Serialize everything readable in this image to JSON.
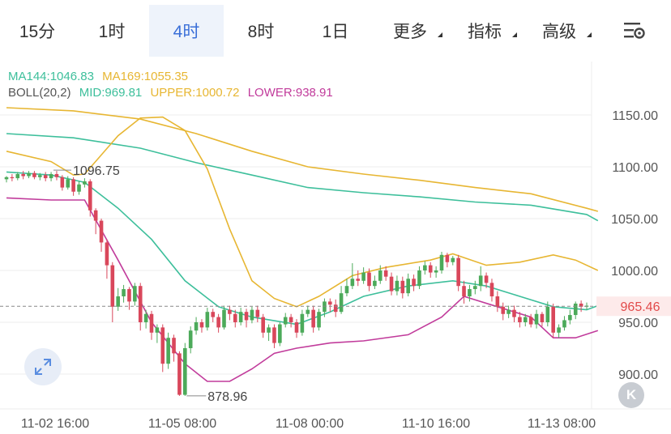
{
  "tabs": [
    {
      "label": "15分",
      "active": false,
      "dropdown": false
    },
    {
      "label": "1时",
      "active": false,
      "dropdown": false
    },
    {
      "label": "4时",
      "active": true,
      "dropdown": false
    },
    {
      "label": "8时",
      "active": false,
      "dropdown": false
    },
    {
      "label": "1日",
      "active": false,
      "dropdown": false
    },
    {
      "label": "更多",
      "active": false,
      "dropdown": true
    },
    {
      "label": "指标",
      "active": false,
      "dropdown": true
    },
    {
      "label": "高级",
      "active": false,
      "dropdown": true
    }
  ],
  "indicators": {
    "ma144": "MA144:1046.83",
    "ma169": "MA169:1055.35",
    "boll": "BOLL(20,2)",
    "mid": "MID:969.81",
    "upper": "UPPER:1000.72",
    "lower": "LOWER:938.91"
  },
  "colors": {
    "ma144": "#3dbf9b",
    "ma169": "#e7b632",
    "mid": "#3dbf9b",
    "upper": "#e7b632",
    "lower": "#c13b9b",
    "up": "#4caa5a",
    "down": "#d9475b",
    "price_tag": "#e24a4a",
    "text": "#555555"
  },
  "chart_data": {
    "type": "candlestick",
    "x_ticks": [
      "11-02 16:00",
      "11-05 08:00",
      "11-08 00:00",
      "11-10 16:00",
      "11-13 08:00"
    ],
    "y_ticks": [
      1150.0,
      1100.0,
      1050.0,
      1000.0,
      950.0,
      900.0
    ],
    "ylim": [
      880,
      1165
    ],
    "current_price": 965.46,
    "annotations": {
      "high": 1096.75,
      "low": 878.96
    },
    "candles": [
      [
        1088,
        1090,
        1085,
        1091
      ],
      [
        1090,
        1089,
        1086,
        1093
      ],
      [
        1089,
        1093,
        1087,
        1095
      ],
      [
        1093,
        1091,
        1088,
        1096
      ],
      [
        1091,
        1094,
        1089,
        1096
      ],
      [
        1094,
        1090,
        1088,
        1096
      ],
      [
        1090,
        1092,
        1087,
        1094
      ],
      [
        1092,
        1089,
        1086,
        1095
      ],
      [
        1089,
        1093,
        1086,
        1095
      ],
      [
        1093,
        1090,
        1087,
        1096
      ],
      [
        1090,
        1080,
        1077,
        1092
      ],
      [
        1080,
        1088,
        1078,
        1091
      ],
      [
        1088,
        1076,
        1072,
        1090
      ],
      [
        1076,
        1083,
        1073,
        1086
      ],
      [
        1083,
        1086,
        1080,
        1089
      ],
      [
        1086,
        1058,
        1052,
        1088
      ],
      [
        1058,
        1048,
        1035,
        1060
      ],
      [
        1048,
        1027,
        1018,
        1050
      ],
      [
        1027,
        1005,
        992,
        1030
      ],
      [
        1005,
        965,
        950,
        1008
      ],
      [
        965,
        975,
        961,
        983
      ],
      [
        975,
        982,
        969,
        986
      ],
      [
        982,
        970,
        962,
        984
      ],
      [
        970,
        985,
        966,
        988
      ],
      [
        985,
        950,
        942,
        988
      ],
      [
        950,
        958,
        944,
        962
      ],
      [
        958,
        940,
        933,
        961
      ],
      [
        940,
        945,
        930,
        948
      ],
      [
        945,
        910,
        902,
        948
      ],
      [
        910,
        935,
        905,
        940
      ],
      [
        935,
        920,
        912,
        938
      ],
      [
        920,
        880,
        878.96,
        922
      ],
      [
        880,
        925,
        878.96,
        930
      ],
      [
        925,
        942,
        920,
        946
      ],
      [
        942,
        950,
        938,
        955
      ],
      [
        950,
        945,
        940,
        953
      ],
      [
        945,
        960,
        942,
        964
      ],
      [
        960,
        955,
        950,
        963
      ],
      [
        955,
        945,
        940,
        958
      ],
      [
        945,
        962,
        943,
        966
      ],
      [
        962,
        958,
        952,
        966
      ],
      [
        958,
        950,
        945,
        962
      ],
      [
        950,
        960,
        947,
        964
      ],
      [
        960,
        952,
        945,
        963
      ],
      [
        952,
        962,
        949,
        965
      ],
      [
        962,
        955,
        950,
        966
      ],
      [
        955,
        940,
        935,
        958
      ],
      [
        940,
        945,
        932,
        948
      ],
      [
        945,
        930,
        925,
        948
      ],
      [
        930,
        948,
        927,
        950
      ],
      [
        948,
        955,
        945,
        959
      ],
      [
        955,
        950,
        945,
        958
      ],
      [
        950,
        940,
        935,
        953
      ],
      [
        940,
        958,
        937,
        962
      ],
      [
        958,
        962,
        955,
        966
      ],
      [
        962,
        945,
        940,
        966
      ],
      [
        945,
        960,
        942,
        963
      ],
      [
        960,
        970,
        955,
        973
      ],
      [
        970,
        967,
        960,
        973
      ],
      [
        967,
        960,
        955,
        972
      ],
      [
        960,
        978,
        958,
        985
      ],
      [
        978,
        985,
        975,
        992
      ],
      [
        985,
        992,
        982,
        1007
      ],
      [
        992,
        990,
        985,
        1000
      ],
      [
        990,
        998,
        987,
        1003
      ],
      [
        998,
        985,
        980,
        1002
      ],
      [
        985,
        990,
        982,
        995
      ],
      [
        990,
        1000,
        987,
        1005
      ],
      [
        1000,
        994,
        990,
        1004
      ],
      [
        994,
        980,
        976,
        998
      ],
      [
        980,
        990,
        976,
        995
      ],
      [
        990,
        978,
        973,
        994
      ],
      [
        978,
        992,
        975,
        997
      ],
      [
        992,
        985,
        980,
        996
      ],
      [
        985,
        1000,
        982,
        1004
      ],
      [
        1000,
        1005,
        996,
        1009
      ],
      [
        1005,
        998,
        993,
        1008
      ],
      [
        998,
        1000,
        993,
        1004
      ],
      [
        1000,
        1015,
        997,
        1018
      ],
      [
        1015,
        1008,
        1003,
        1017
      ],
      [
        1008,
        1012,
        1005,
        1014
      ],
      [
        1012,
        985,
        980,
        1015
      ],
      [
        985,
        975,
        968,
        990
      ],
      [
        975,
        982,
        970,
        986
      ],
      [
        982,
        985,
        977,
        990
      ],
      [
        985,
        995,
        980,
        1004
      ],
      [
        995,
        988,
        983,
        998
      ],
      [
        988,
        975,
        970,
        992
      ],
      [
        975,
        965,
        960,
        980
      ],
      [
        965,
        958,
        952,
        969
      ],
      [
        958,
        962,
        954,
        966
      ],
      [
        962,
        955,
        950,
        966
      ],
      [
        955,
        950,
        945,
        960
      ],
      [
        950,
        955,
        946,
        958
      ],
      [
        955,
        948,
        945,
        958
      ],
      [
        948,
        958,
        944,
        962
      ],
      [
        958,
        950,
        946,
        960
      ],
      [
        950,
        965,
        946,
        970
      ],
      [
        965,
        940,
        935,
        968
      ],
      [
        940,
        945,
        935,
        948
      ],
      [
        945,
        952,
        942,
        956
      ],
      [
        952,
        957,
        948,
        962
      ],
      [
        957,
        968,
        953,
        970
      ],
      [
        968,
        965,
        960,
        971
      ],
      [
        965,
        966,
        962,
        969
      ]
    ],
    "series": [
      {
        "name": "MA144",
        "points": [
          [
            0,
            1132
          ],
          [
            12,
            1128
          ],
          [
            24,
            1118
          ],
          [
            34,
            1104
          ],
          [
            44,
            1092
          ],
          [
            54,
            1080
          ],
          [
            64,
            1075
          ],
          [
            74,
            1071
          ],
          [
            84,
            1066
          ],
          [
            94,
            1063
          ],
          [
            104,
            1054
          ],
          [
            106,
            1048
          ]
        ]
      },
      {
        "name": "MA169",
        "points": [
          [
            0,
            1157
          ],
          [
            12,
            1154
          ],
          [
            24,
            1146
          ],
          [
            34,
            1132
          ],
          [
            44,
            1115
          ],
          [
            54,
            1100
          ],
          [
            64,
            1093
          ],
          [
            74,
            1087
          ],
          [
            84,
            1080
          ],
          [
            94,
            1074
          ],
          [
            104,
            1060
          ],
          [
            106,
            1057
          ]
        ]
      },
      {
        "name": "MID",
        "points": [
          [
            0,
            1095
          ],
          [
            8,
            1092
          ],
          [
            14,
            1085
          ],
          [
            20,
            1060
          ],
          [
            26,
            1030
          ],
          [
            32,
            990
          ],
          [
            38,
            965
          ],
          [
            44,
            955
          ],
          [
            52,
            948
          ],
          [
            58,
            960
          ],
          [
            64,
            975
          ],
          [
            72,
            985
          ],
          [
            80,
            990
          ],
          [
            86,
            985
          ],
          [
            92,
            975
          ],
          [
            98,
            965
          ],
          [
            104,
            962
          ],
          [
            106,
            966
          ]
        ]
      },
      {
        "name": "UPPER",
        "points": [
          [
            0,
            1115
          ],
          [
            8,
            1105
          ],
          [
            12,
            1092
          ],
          [
            14,
            1093
          ],
          [
            20,
            1130
          ],
          [
            24,
            1147
          ],
          [
            28,
            1148
          ],
          [
            32,
            1135
          ],
          [
            36,
            1098
          ],
          [
            40,
            1040
          ],
          [
            44,
            990
          ],
          [
            48,
            973
          ],
          [
            52,
            965
          ],
          [
            56,
            975
          ],
          [
            62,
            995
          ],
          [
            68,
            1003
          ],
          [
            76,
            1010
          ],
          [
            80,
            1016
          ],
          [
            86,
            1005
          ],
          [
            92,
            1008
          ],
          [
            98,
            1015
          ],
          [
            102,
            1010
          ],
          [
            106,
            1000
          ]
        ]
      },
      {
        "name": "LOWER",
        "points": [
          [
            0,
            1070
          ],
          [
            8,
            1068
          ],
          [
            14,
            1068
          ],
          [
            20,
            1010
          ],
          [
            26,
            950
          ],
          [
            32,
            910
          ],
          [
            36,
            893
          ],
          [
            40,
            893
          ],
          [
            44,
            905
          ],
          [
            48,
            920
          ],
          [
            52,
            925
          ],
          [
            58,
            930
          ],
          [
            64,
            932
          ],
          [
            72,
            938
          ],
          [
            78,
            955
          ],
          [
            82,
            975
          ],
          [
            88,
            965
          ],
          [
            94,
            955
          ],
          [
            98,
            935
          ],
          [
            102,
            935
          ],
          [
            106,
            942
          ]
        ]
      }
    ]
  }
}
